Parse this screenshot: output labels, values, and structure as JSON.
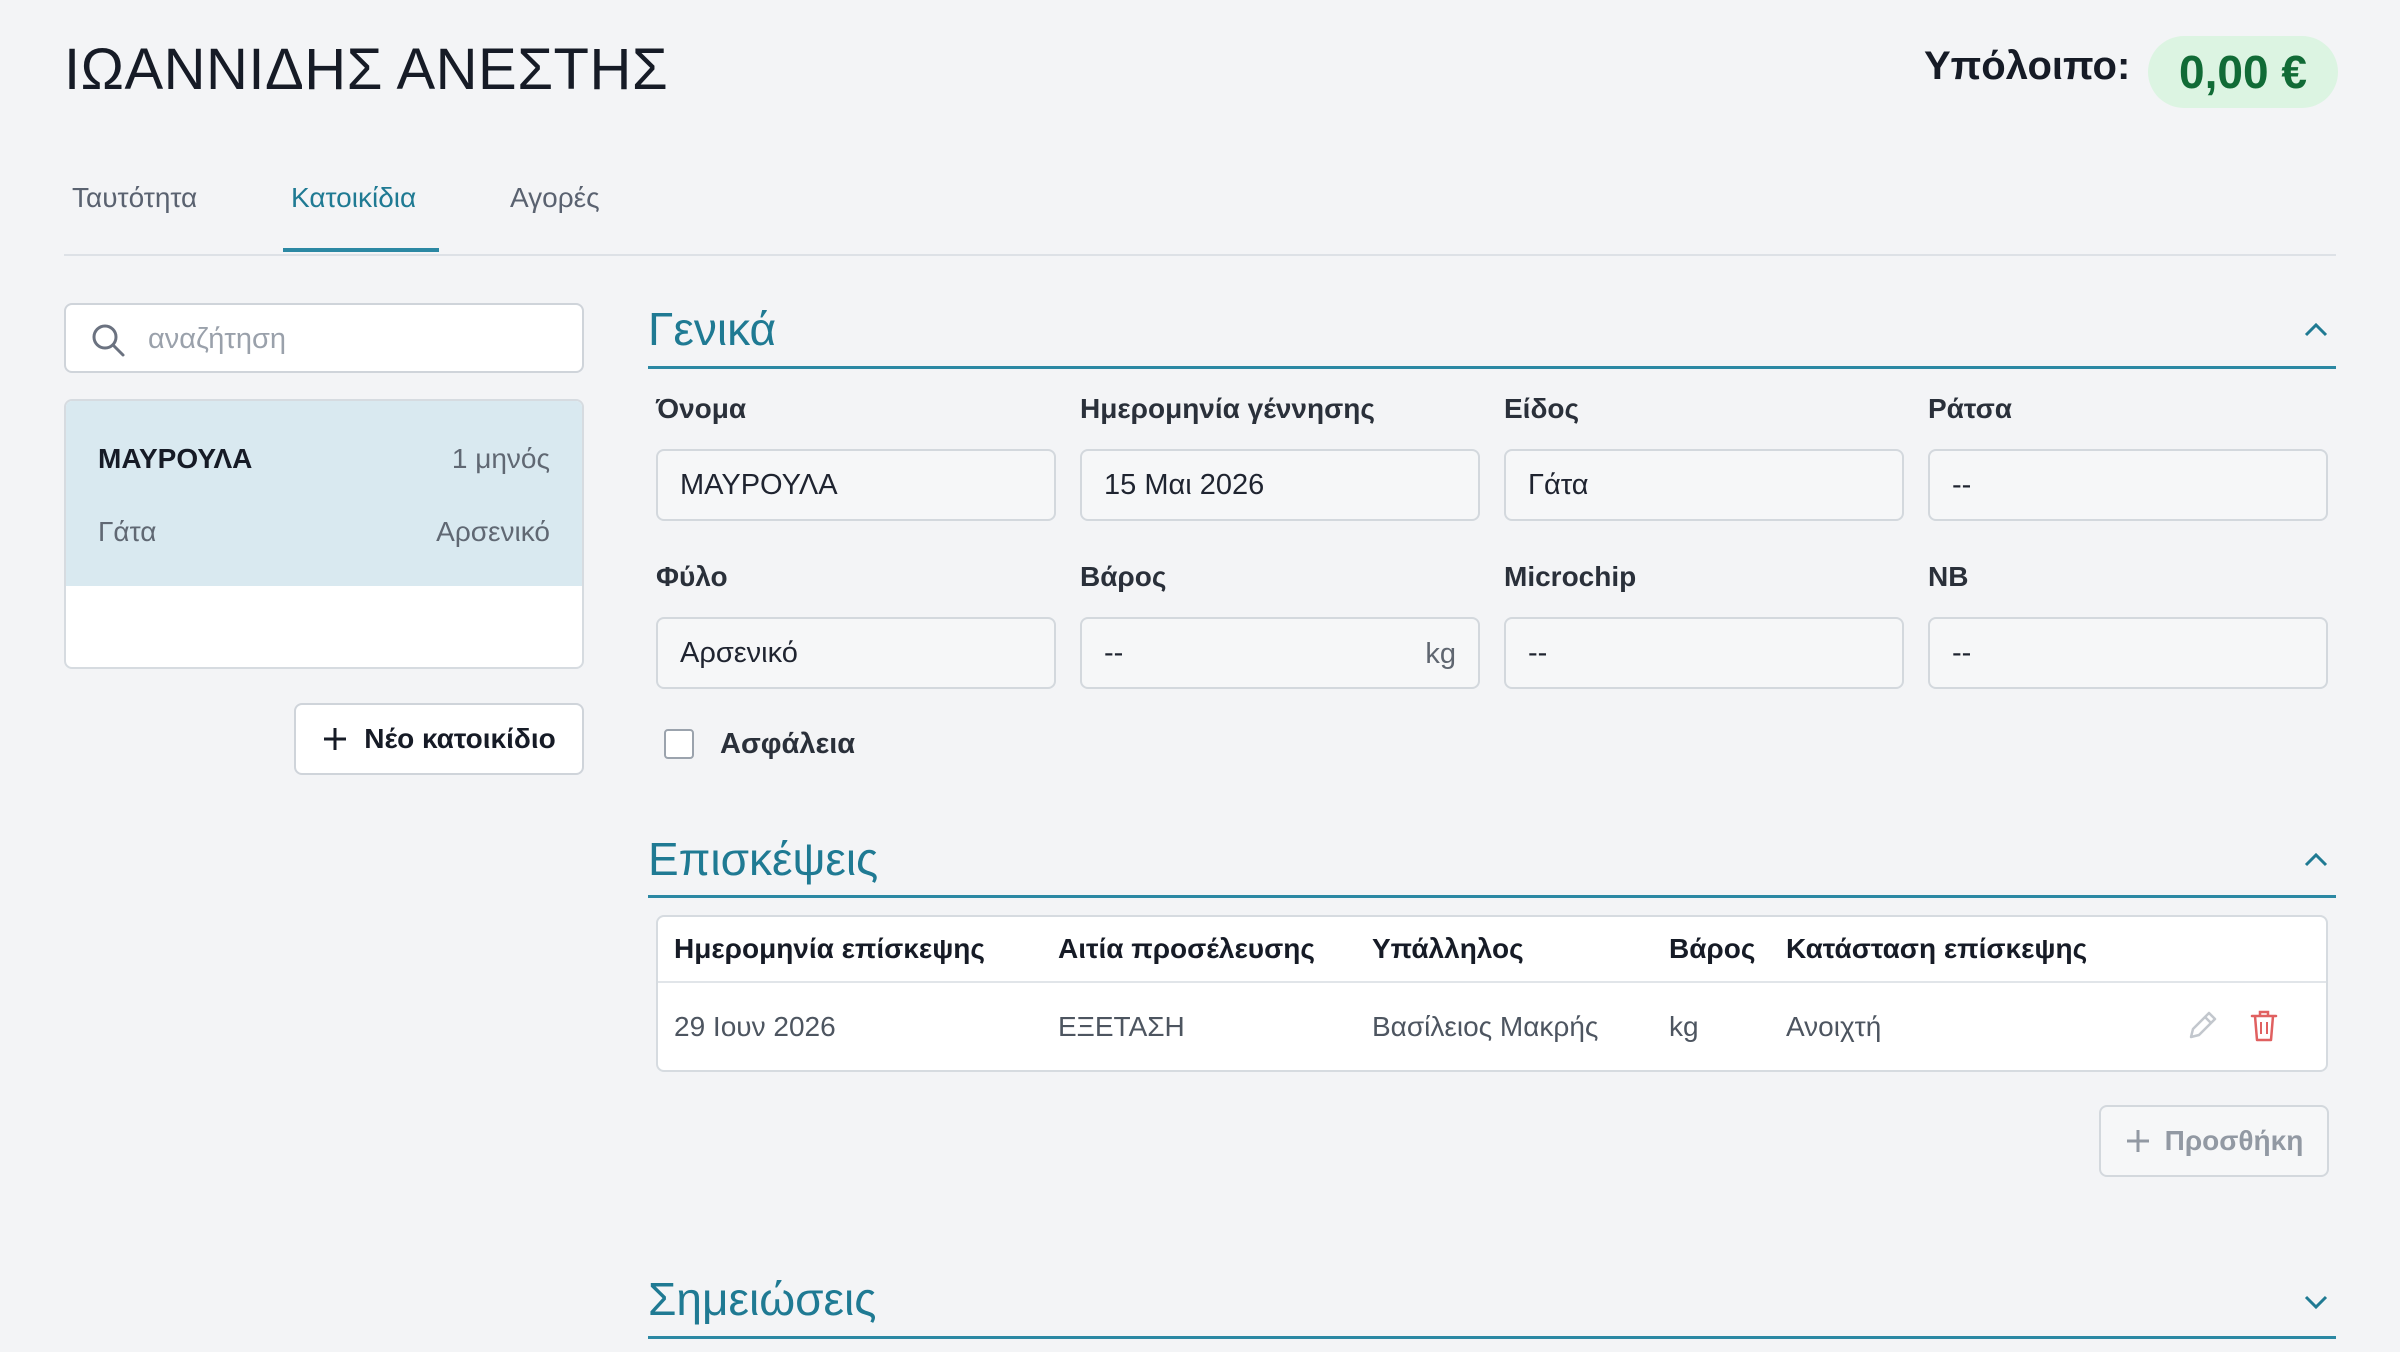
{
  "header": {
    "client_name": "ΙΩΑΝΝΙΔΗΣ ΑΝΕΣΤΗΣ",
    "balance_label": "Υπόλοιπο:",
    "balance_value": "0,00 €"
  },
  "tabs": [
    {
      "label": "Ταυτότητα",
      "active": false
    },
    {
      "label": "Κατοικίδια",
      "active": true
    },
    {
      "label": "Αγορές",
      "active": false
    }
  ],
  "sidebar": {
    "search_placeholder": "αναζήτηση",
    "pets": [
      {
        "name": "ΜΑΥΡΟΥΛΑ",
        "age": "1 μηνός",
        "species": "Γάτα",
        "sex": "Αρσενικό",
        "selected": true
      }
    ],
    "new_pet_label": "Νέο κατοικίδιο"
  },
  "general": {
    "title": "Γενικά",
    "fields": {
      "name": {
        "label": "Όνομα",
        "value": "ΜΑΥΡΟΥΛΑ"
      },
      "birthdate": {
        "label": "Ημερομηνία γέννησης",
        "value": "15 Μαι 2026"
      },
      "species": {
        "label": "Είδος",
        "value": "Γάτα"
      },
      "breed": {
        "label": "Ράτσα",
        "value": "--"
      },
      "sex": {
        "label": "Φύλο",
        "value": "Αρσενικό"
      },
      "weight": {
        "label": "Βάρος",
        "value": "--",
        "unit": "kg"
      },
      "microchip": {
        "label": "Microchip",
        "value": "--"
      },
      "nb": {
        "label": "NB",
        "value": "--"
      }
    },
    "insurance_label": "Ασφάλεια",
    "insurance_checked": false
  },
  "visits": {
    "title": "Επισκέψεις",
    "columns": [
      "Ημερομηνία επίσκεψης",
      "Αιτία προσέλευσης",
      "Υπάλληλος",
      "Βάρος",
      "Κατάσταση επίσκεψης"
    ],
    "rows": [
      [
        "29 Ιουν 2026",
        "ΕΞΕΤΑΣΗ",
        "Βασίλειος Μακρής",
        "kg",
        "Ανοιχτή"
      ]
    ],
    "add_label": "Προσθήκη"
  },
  "notes": {
    "title": "Σημειώσεις"
  },
  "colors": {
    "accent": "#2b88a3",
    "balance_bg": "#dcf4e2",
    "balance_text": "#116b36",
    "selected_pet_bg": "#d9e9f0",
    "delete": "#e06060"
  },
  "icons": [
    "search-icon",
    "plus-icon",
    "chevron-up-icon",
    "chevron-down-icon",
    "pencil-icon",
    "trash-icon"
  ]
}
